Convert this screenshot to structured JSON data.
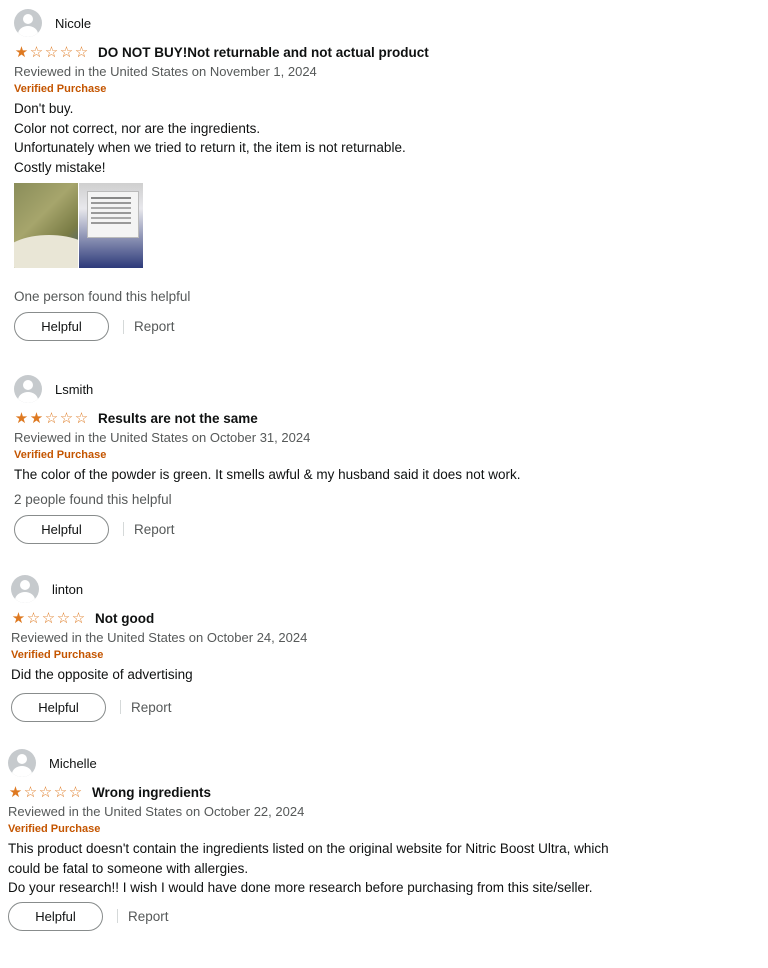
{
  "reviews": [
    {
      "name": "Nicole",
      "rating": 1,
      "title": "DO NOT BUY!Not returnable and not actual product",
      "date": "Reviewed in the United States on November 1, 2024",
      "verified": "Verified Purchase",
      "body": [
        "Don't buy.",
        "Color not correct, nor are the ingredients.",
        "Unfortunately when we tried to return it, the item is not returnable.",
        "Costly mistake!"
      ],
      "helpful_count": "One person found this helpful",
      "helpful_label": "Helpful",
      "report_label": "Report"
    },
    {
      "name": "Lsmith",
      "rating": 2,
      "title": "Results are not the same",
      "date": "Reviewed in the United States on October 31, 2024",
      "verified": "Verified Purchase",
      "body": [
        "The color of the powder is green. It smells awful & my husband said it does not work."
      ],
      "helpful_count": "2 people found this helpful",
      "helpful_label": "Helpful",
      "report_label": "Report"
    },
    {
      "name": "linton",
      "rating": 1,
      "title": "Not good",
      "date": "Reviewed in the United States on October 24, 2024",
      "verified": "Verified Purchase",
      "body": [
        "Did the opposite of advertising"
      ],
      "helpful_label": "Helpful",
      "report_label": "Report"
    },
    {
      "name": "Michelle",
      "rating": 1,
      "title": "Wrong ingredients",
      "date": "Reviewed in the United States on October 22, 2024",
      "verified": "Verified Purchase",
      "body": [
        "This product doesn't contain the ingredients listed on the original website for Nitric Boost Ultra, which",
        "could be fatal to someone with allergies.",
        "Do your research!! I wish I would have done more research before purchasing from this site/seller."
      ],
      "helpful_label": "Helpful",
      "report_label": "Report"
    }
  ],
  "colors": {
    "star": "#de7921",
    "verified": "#c45500",
    "muted": "#565959"
  }
}
